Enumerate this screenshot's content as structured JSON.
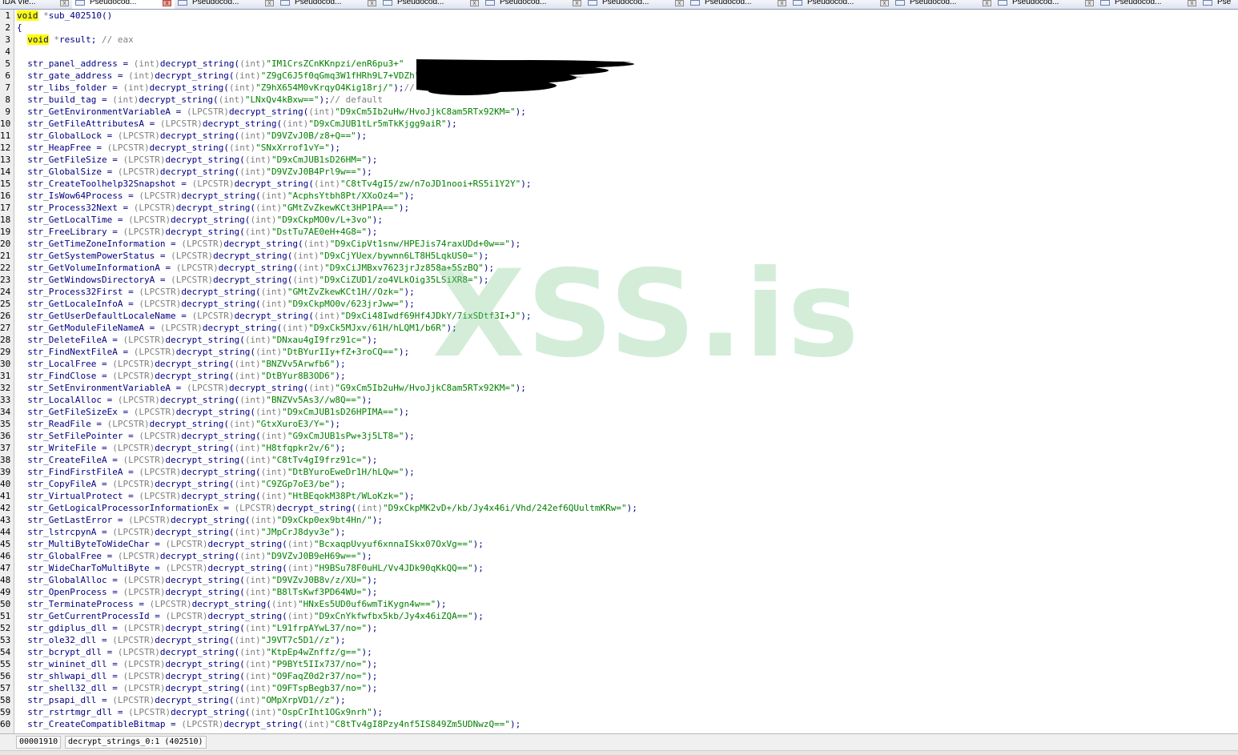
{
  "tabs": [
    {
      "label": "IDA Vie...",
      "close": "x",
      "icon": "ida-view-icon"
    },
    {
      "label": "Pseudocod...",
      "close": "x",
      "icon": "pseudocode-icon"
    },
    {
      "label": "Pseudocod...",
      "close": "x",
      "icon": "pseudocode-icon"
    },
    {
      "label": "Pseudocod...",
      "close": "x",
      "icon": "pseudocode-icon"
    },
    {
      "label": "Pseudocod...",
      "close": "x",
      "icon": "pseudocode-icon"
    },
    {
      "label": "Pseudocod...",
      "close": "x",
      "icon": "pseudocode-icon"
    },
    {
      "label": "Pseudocod...",
      "close": "x",
      "icon": "pseudocode-icon"
    },
    {
      "label": "Pseudocod...",
      "close": "x",
      "icon": "pseudocode-icon"
    },
    {
      "label": "Pseudocod...",
      "close": "x",
      "icon": "pseudocode-icon"
    },
    {
      "label": "Pseudocod...",
      "close": "x",
      "icon": "pseudocode-icon"
    },
    {
      "label": "Pseudocod...",
      "close": "x",
      "icon": "pseudocode-icon"
    },
    {
      "label": "Pseudocod...",
      "close": "x",
      "icon": "pseudocode-icon"
    },
    {
      "label": "Pse",
      "close": "",
      "icon": "pseudocode-icon"
    }
  ],
  "colors": {
    "keyword_highlight": "#ffff00",
    "code_text": "#000080",
    "string_literal": "#008000",
    "cast_type": "#7f7f7f",
    "watermark": "#78c88c"
  },
  "code": {
    "header": [
      {
        "n": "1",
        "parts": [
          [
            "kw",
            "void"
          ],
          [
            "typ",
            " *"
          ],
          [
            "",
            "sub_402510()"
          ]
        ]
      },
      {
        "n": "2",
        "parts": [
          [
            "",
            "{"
          ]
        ]
      },
      {
        "n": "3",
        "parts": [
          [
            "",
            "  "
          ],
          [
            "kw",
            "void"
          ],
          [
            "typ",
            " *"
          ],
          [
            "",
            "result; "
          ],
          [
            "cmt",
            "// eax"
          ]
        ]
      },
      {
        "n": "4",
        "parts": []
      }
    ],
    "assignments": [
      {
        "n": "5",
        "var": "str_panel_address",
        "cast": "int",
        "arg": "IM1CrsZCnKKnpzi/enR6pu3+",
        "tail": ""
      },
      {
        "n": "6",
        "var": "str_gate_address",
        "cast": "int",
        "arg": "Z9gC6J5f0qGmq3W1fHRh9L7+VDZh",
        "tail": ""
      },
      {
        "n": "7",
        "var": "str_libs_folder",
        "cast": "int",
        "arg": "Z9hX654M0vKrqyO4Kig18rj/",
        "tail": ");//"
      },
      {
        "n": "8",
        "var": "str_build_tag",
        "cast": "int",
        "arg": "LNxQv4kBxw==",
        "tail": ");// default"
      },
      {
        "n": "9",
        "var": "str_GetEnvironmentVariableA",
        "cast": "LPCSTR",
        "arg": "D9xCm5Ib2uHw/HvoJjkC8am5RTx92KM=",
        "tail": ");"
      },
      {
        "n": "10",
        "var": "str_GetFileAttributesA",
        "cast": "LPCSTR",
        "arg": "D9xCmJUB1tLr5mTkKjgg9aiR",
        "tail": ");"
      },
      {
        "n": "11",
        "var": "str_GlobalLock",
        "cast": "LPCSTR",
        "arg": "D9VZvJ0B/z8+Q==",
        "tail": ");"
      },
      {
        "n": "12",
        "var": "str_HeapFree",
        "cast": "LPCSTR",
        "arg": "SNxXrrof1vY=",
        "tail": ");"
      },
      {
        "n": "13",
        "var": "str_GetFileSize",
        "cast": "LPCSTR",
        "arg": "D9xCmJUB1sD26HM=",
        "tail": ");"
      },
      {
        "n": "14",
        "var": "str_GlobalSize",
        "cast": "LPCSTR",
        "arg": "D9VZvJ0B4Prl9w==",
        "tail": ");"
      },
      {
        "n": "15",
        "var": "str_CreateToolhelp32Snapshot",
        "cast": "LPCSTR",
        "arg": "C8tTv4gI5/zw/n7oJD1nooi+RS5i1Y2Y",
        "tail": ");"
      },
      {
        "n": "16",
        "var": "str_IsWow64Process",
        "cast": "LPCSTR",
        "arg": "AcphsYtbh8Pt/XXoOz4=",
        "tail": ");"
      },
      {
        "n": "17",
        "var": "str_Process32Next",
        "cast": "LPCSTR",
        "arg": "GMtZvZkewKCt3HP1PA==",
        "tail": ");"
      },
      {
        "n": "18",
        "var": "str_GetLocalTime",
        "cast": "LPCSTR",
        "arg": "D9xCkpMO0v/L+3vo",
        "tail": ");"
      },
      {
        "n": "19",
        "var": "str_FreeLibrary",
        "cast": "LPCSTR",
        "arg": "DstTu7AE0eH+4G8=",
        "tail": ");"
      },
      {
        "n": "20",
        "var": "str_GetTimeZoneInformation",
        "cast": "LPCSTR",
        "arg": "D9xCipVt1snw/HPEJis74raxUDd+0w==",
        "tail": ");"
      },
      {
        "n": "21",
        "var": "str_GetSystemPowerStatus",
        "cast": "LPCSTR",
        "arg": "D9xCjYUex/bywnn6LT8H5LqkUS0=",
        "tail": ");"
      },
      {
        "n": "22",
        "var": "str_GetVolumeInformationA",
        "cast": "LPCSTR",
        "arg": "D9xCiJMBxv7623jrJz858a+5SzBQ",
        "tail": ");"
      },
      {
        "n": "23",
        "var": "str_GetWindowsDirectoryA",
        "cast": "LPCSTR",
        "arg": "D9xCiZUD1/zo4VLkOig35LSiXR8=",
        "tail": ");"
      },
      {
        "n": "24",
        "var": "str_Process32First",
        "cast": "LPCSTR",
        "arg": "GMtZvZkewKCt1H//Ozk=",
        "tail": ");"
      },
      {
        "n": "25",
        "var": "str_GetLocaleInfoA",
        "cast": "LPCSTR",
        "arg": "D9xCkpMO0v/623jrJww=",
        "tail": ");"
      },
      {
        "n": "26",
        "var": "str_GetUserDefaultLocaleName",
        "cast": "LPCSTR",
        "arg": "D9xCi48Iwdf69Hf4JDkY/7ixSDtf3I+J",
        "tail": ");"
      },
      {
        "n": "27",
        "var": "str_GetModuleFileNameA",
        "cast": "LPCSTR",
        "arg": "D9xCk5MJxv/61H/hLQM1/b6R",
        "tail": ");"
      },
      {
        "n": "28",
        "var": "str_DeleteFileA",
        "cast": "LPCSTR",
        "arg": "DNxau4gI9frz91c=",
        "tail": ");"
      },
      {
        "n": "29",
        "var": "str_FindNextFileA",
        "cast": "LPCSTR",
        "arg": "DtBYurIIy+fZ+3roCQ==",
        "tail": ");"
      },
      {
        "n": "30",
        "var": "str_LocalFree",
        "cast": "LPCSTR",
        "arg": "BNZVv5Arwfb6",
        "tail": ");"
      },
      {
        "n": "31",
        "var": "str_FindClose",
        "cast": "LPCSTR",
        "arg": "DtBYur8B3OD6",
        "tail": ");"
      },
      {
        "n": "32",
        "var": "str_SetEnvironmentVariableA",
        "cast": "LPCSTR",
        "arg": "G9xCm5Ib2uHw/HvoJjkC8am5RTx92KM=",
        "tail": ");"
      },
      {
        "n": "33",
        "var": "str_LocalAlloc",
        "cast": "LPCSTR",
        "arg": "BNZVv5As3//w8Q==",
        "tail": ");"
      },
      {
        "n": "34",
        "var": "str_GetFileSizeEx",
        "cast": "LPCSTR",
        "arg": "D9xCmJUB1sD26HPIMA==",
        "tail": ");"
      },
      {
        "n": "35",
        "var": "str_ReadFile",
        "cast": "LPCSTR",
        "arg": "GtxXuroE3/Y=",
        "tail": ");"
      },
      {
        "n": "36",
        "var": "str_SetFilePointer",
        "cast": "LPCSTR",
        "arg": "G9xCmJUB1sPw+3j5LT8=",
        "tail": ");"
      },
      {
        "n": "37",
        "var": "str_WriteFile",
        "cast": "LPCSTR",
        "arg": "H8tfqpkr2v/6",
        "tail": ");"
      },
      {
        "n": "38",
        "var": "str_CreateFileA",
        "cast": "LPCSTR",
        "arg": "C8tTv4gI9frz91c=",
        "tail": ");"
      },
      {
        "n": "39",
        "var": "str_FindFirstFileA",
        "cast": "LPCSTR",
        "arg": "DtBYuroEweDr1H/hLQw=",
        "tail": ");"
      },
      {
        "n": "40",
        "var": "str_CopyFileA",
        "cast": "LPCSTR",
        "arg": "C9ZGp7oE3/be",
        "tail": ");"
      },
      {
        "n": "41",
        "var": "str_VirtualProtect",
        "cast": "LPCSTR",
        "arg": "HtBEqokM38Pt/WLoKzk=",
        "tail": ");"
      },
      {
        "n": "42",
        "var": "str_GetLogicalProcessorInformationEx",
        "cast": "LPCSTR",
        "arg": "D9xCkpMK2vD+/kb/Jy4x46i/Vhd/242ef6QUultmKRw=",
        "tail": ");"
      },
      {
        "n": "43",
        "var": "str_GetLastError",
        "cast": "LPCSTR",
        "arg": "D9xCkp0ex9bt4Hn/",
        "tail": ");"
      },
      {
        "n": "44",
        "var": "str_lstrcpynA",
        "cast": "LPCSTR",
        "arg": "JMpCrJ8dyv3e",
        "tail": ");"
      },
      {
        "n": "45",
        "var": "str_MultiByteToWideChar",
        "cast": "LPCSTR",
        "arg": "BcxaqpUvyuf6xnnaISkx07OxVg==",
        "tail": ");"
      },
      {
        "n": "46",
        "var": "str_GlobalFree",
        "cast": "LPCSTR",
        "arg": "D9VZvJ0B9eH69w==",
        "tail": ");"
      },
      {
        "n": "47",
        "var": "str_WideCharToMultiByte",
        "cast": "LPCSTR",
        "arg": "H9BSu78F0uHL/Vv4JDk90qKkQQ==",
        "tail": ");"
      },
      {
        "n": "48",
        "var": "str_GlobalAlloc",
        "cast": "LPCSTR",
        "arg": "D9VZvJ0B8v/z/XU=",
        "tail": ");"
      },
      {
        "n": "49",
        "var": "str_OpenProcess",
        "cast": "LPCSTR",
        "arg": "B8lTsKwf3PD64WU=",
        "tail": ");"
      },
      {
        "n": "50",
        "var": "str_TerminateProcess",
        "cast": "LPCSTR",
        "arg": "HNxEs5UD0uf6wmTiKygn4w==",
        "tail": ");"
      },
      {
        "n": "51",
        "var": "str_GetCurrentProcessId",
        "cast": "LPCSTR",
        "arg": "D9xCnYkfwfbx5kb/Jy4x46iZQA==",
        "tail": ");"
      },
      {
        "n": "52",
        "var": "str_gdiplus_dll",
        "cast": "LPCSTR",
        "arg": "L91frpAYwL37/no=",
        "tail": ");"
      },
      {
        "n": "53",
        "var": "str_ole32_dll",
        "cast": "LPCSTR",
        "arg": "J9VT7c5D1//z",
        "tail": ");"
      },
      {
        "n": "54",
        "var": "str_bcrypt_dll",
        "cast": "LPCSTR",
        "arg": "KtpEp4wZnffz/g==",
        "tail": ");"
      },
      {
        "n": "55",
        "var": "str_wininet_dll",
        "cast": "LPCSTR",
        "arg": "P9BYt5IIx737/no=",
        "tail": ");"
      },
      {
        "n": "56",
        "var": "str_shlwapi_dll",
        "cast": "LPCSTR",
        "arg": "O9FaqZ0d2r37/no=",
        "tail": ");"
      },
      {
        "n": "57",
        "var": "str_shell32_dll",
        "cast": "LPCSTR",
        "arg": "O9FTspBegb37/no=",
        "tail": ");"
      },
      {
        "n": "58",
        "var": "str_psapi_dll",
        "cast": "LPCSTR",
        "arg": "OMpXrpVD1//z",
        "tail": ");"
      },
      {
        "n": "59",
        "var": "str_rstrtmgr_dll",
        "cast": "LPCSTR",
        "arg": "OspCrIht1OGx9nrh",
        "tail": ");"
      },
      {
        "n": "60",
        "var": "str_CreateCompatibleBitmap",
        "cast": "LPCSTR",
        "arg": "C8tTv4gI8Pzy4nf5IS849Zm5UDNwzQ==",
        "tail": ");"
      }
    ]
  },
  "watermark": "XSS.is",
  "status": {
    "address": "00001910",
    "location": "decrypt_strings_0:1 (402510)"
  }
}
